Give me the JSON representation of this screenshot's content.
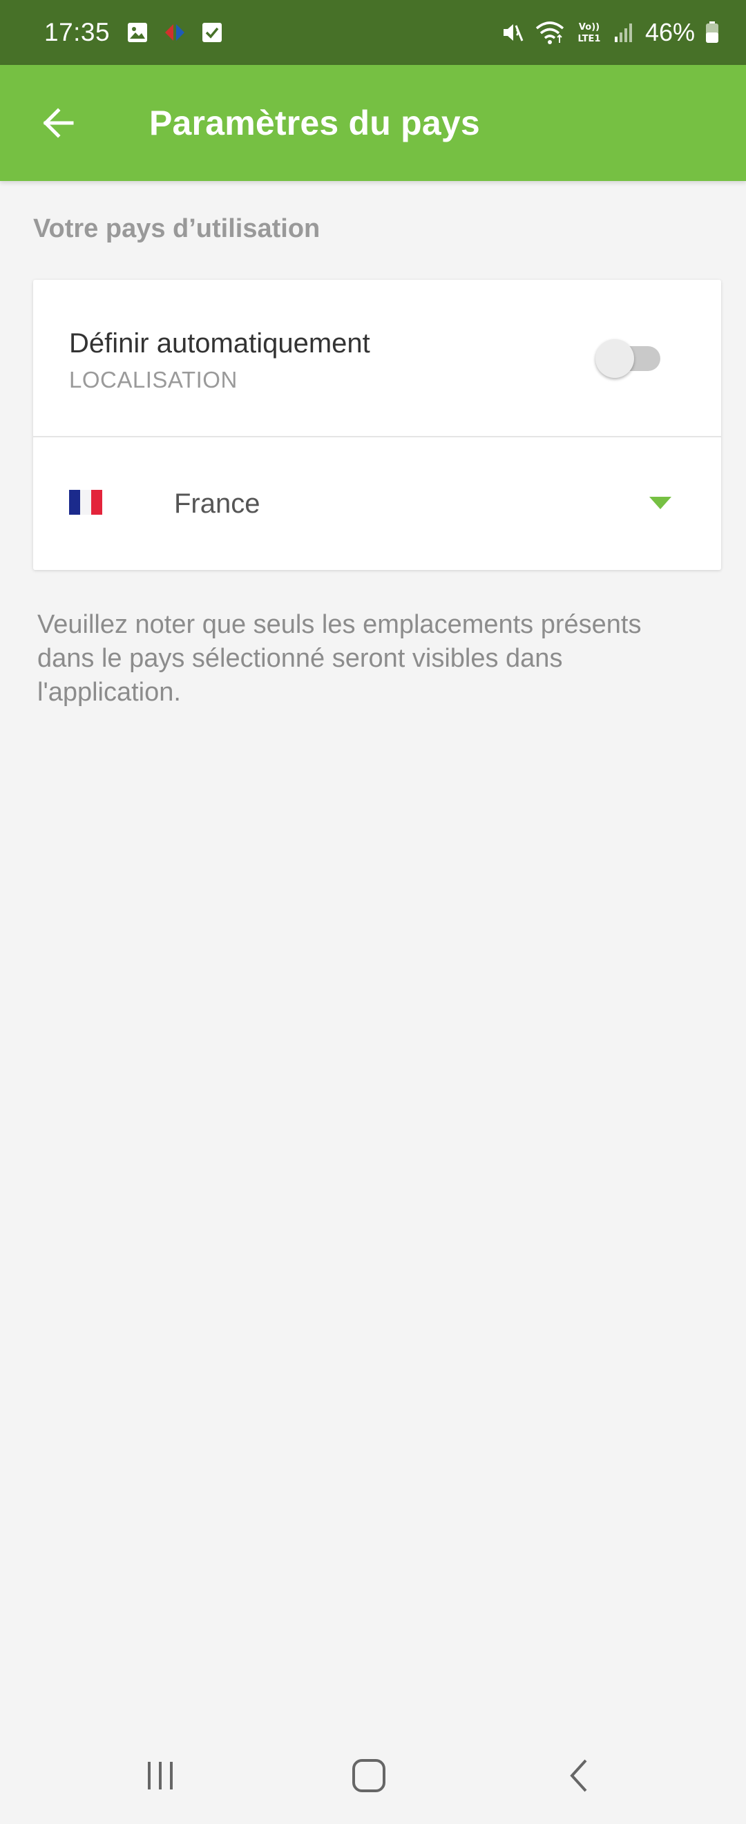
{
  "status_bar": {
    "time": "17:35",
    "battery": "46%",
    "icons": [
      "image-icon",
      "carrefour-icon",
      "checkbox-icon",
      "mute-icon",
      "wifi-icon",
      "volte-icon",
      "signal-icon",
      "battery-icon"
    ]
  },
  "app_bar": {
    "title": "Paramètres du pays",
    "back_icon": "arrow-left-icon"
  },
  "section": {
    "label": "Votre pays d’utilisation"
  },
  "auto_setting": {
    "title": "Définir automatiquement",
    "subtitle": "LOCALISATION",
    "enabled": false
  },
  "country_select": {
    "selected": "France",
    "flag": "france-flag-icon"
  },
  "note": "Veuillez noter que seuls les emplacements présents dans le pays sélectionné seront visibles dans l'application.",
  "colors": {
    "status_bar": "#477128",
    "app_bar": "#76c043",
    "accent": "#76c043",
    "background": "#f4f4f4"
  },
  "nav_bar": {
    "icons": [
      "recent-apps-icon",
      "home-icon",
      "back-icon"
    ]
  }
}
